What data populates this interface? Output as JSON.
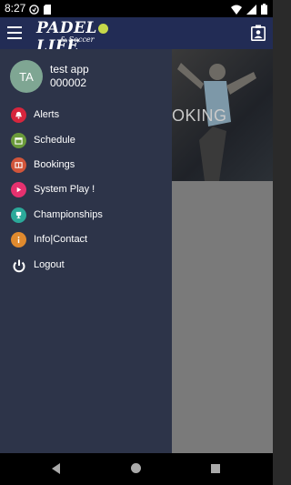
{
  "status_bar": {
    "time": "8:27"
  },
  "header": {
    "logo": {
      "part1": "PADEL",
      "part2": "LIFE",
      "sub": "& Soccer"
    }
  },
  "hero": {
    "text": "OKING"
  },
  "drawer": {
    "avatar_initials": "TA",
    "user_name": "test app",
    "user_id": "000002",
    "items": [
      {
        "label": "Alerts",
        "icon": "bell-icon",
        "color": "#d7263d"
      },
      {
        "label": "Schedule",
        "icon": "calendar-icon",
        "color": "#6a9a3a"
      },
      {
        "label": "Bookings",
        "icon": "booking-icon",
        "color": "#d2553a"
      },
      {
        "label": "System Play !",
        "icon": "play-icon",
        "color": "#e6316f"
      },
      {
        "label": "Championships",
        "icon": "trophy-icon",
        "color": "#2ba99a"
      },
      {
        "label": "Info|Contact",
        "icon": "info-icon",
        "color": "#e08a2e"
      },
      {
        "label": "Logout",
        "icon": "power-icon",
        "color": "#ffffff"
      }
    ]
  }
}
